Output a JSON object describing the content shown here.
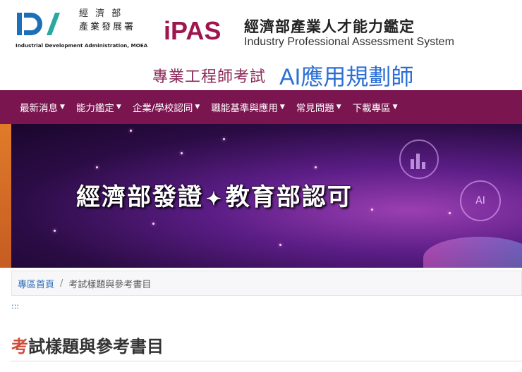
{
  "header": {
    "ida_name_line1": "經 濟 部",
    "ida_name_line2": "產業發展署",
    "ida_name_en": "Industrial Development Administration, MOEA",
    "ipas_logo_text": "iPAS",
    "ipas_name_zh": "經濟部產業人才能力鑑定",
    "ipas_name_en": "Industry Professional Assessment System",
    "exam_label": "專業工程師考試",
    "exam_subject": "AI應用規劃師"
  },
  "nav": {
    "items": [
      {
        "label": "最新消息"
      },
      {
        "label": "能力鑑定"
      },
      {
        "label": "企業/學校認同"
      },
      {
        "label": "職能基準與應用"
      },
      {
        "label": "常見問題"
      },
      {
        "label": "下載專區"
      }
    ]
  },
  "banner": {
    "text_left": "經濟部發證",
    "text_right": "教育部認可",
    "ai_badge": "AI"
  },
  "breadcrumb": {
    "home": "專區首頁",
    "separator": "/",
    "current": "考試樣題與參考書目"
  },
  "accesskey": ":::",
  "page": {
    "title_first_char": "考",
    "title_rest": "試樣題與參考書目"
  },
  "colors": {
    "nav_bg": "#7b1550",
    "title_accent": "#8b2a5a",
    "exam_subject": "#2b6fd6",
    "title_first_char": "#d04a3a"
  }
}
